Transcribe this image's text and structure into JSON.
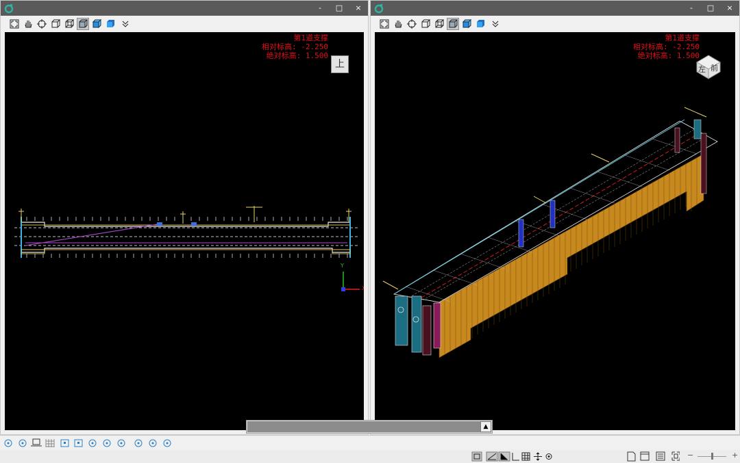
{
  "left_pane": {
    "window_buttons": {
      "minimize": "-",
      "maximize": "□",
      "close": "×"
    },
    "overlay": {
      "stage": "第1道支撑",
      "relative_elevation": "相对标高: -2.250",
      "absolute_elevation": "绝对标高: 1.500"
    },
    "view_cube_label": "上",
    "axis_labels": {
      "y": "Y",
      "x": "X"
    }
  },
  "right_pane": {
    "window_buttons": {
      "minimize": "-",
      "maximize": "□",
      "close": "×"
    },
    "overlay": {
      "stage": "第1道支撑",
      "relative_elevation": "相对标高: -2.250",
      "absolute_elevation": "绝对标高: 1.500"
    },
    "view_cube_labels": {
      "left": "左",
      "front": "前"
    }
  },
  "toolbar_icons": [
    "zoom-extents-icon",
    "pan-hand-icon",
    "orbit-icon",
    "wireframe-box-icon",
    "hidden-line-box-icon",
    "shaded-box-icon",
    "solid-blue-box-icon",
    "solid-blue-cube-icon",
    "more-chevron-icon"
  ],
  "toolbar_active_index": 5,
  "status_bar_zoom": {
    "minus": "−",
    "plus": "+"
  },
  "colors": {
    "titlebar": "#5a5a5a",
    "viewport_bg": "#000000",
    "overlay_text": "#e0101a",
    "wall_fill": "#c88a1e",
    "slab_edge": "#e8e8e8"
  }
}
